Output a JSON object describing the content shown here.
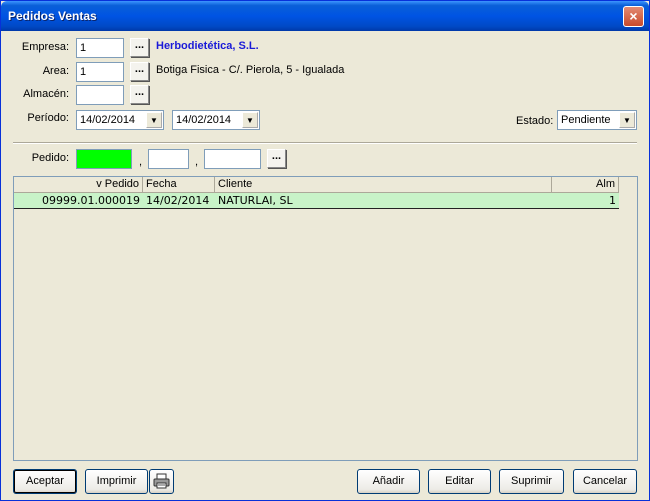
{
  "window": {
    "title": "Pedidos Ventas",
    "close_label": "×"
  },
  "form": {
    "empresa_label": "Empresa:",
    "empresa_value": "1",
    "empresa_name": "Herbodietética, S.L.",
    "area_label": "Area:",
    "area_value": "1",
    "area_name": "Botiga Fisica - C/. Pierola, 5 - Igualada",
    "almacen_label": "Almacén:",
    "almacen_value": "",
    "periodo_label": "Período:",
    "periodo_from": "14/02/2014",
    "periodo_to": "14/02/2014",
    "estado_label": "Estado:",
    "estado_value": "Pendiente",
    "pedido_label": "Pedido:",
    "pedido_sep1": ",",
    "pedido_sep2": ",",
    "dots": "...",
    "dropdown_arrow": "▼"
  },
  "grid": {
    "columns": [
      "v Pedido",
      "Fecha",
      "Cliente",
      "Alm"
    ],
    "rows": [
      {
        "pedido": "09999.01.000019",
        "fecha": "14/02/2014",
        "cliente": "NATURLAI, SL",
        "alm": "1"
      }
    ]
  },
  "buttons": {
    "aceptar": "Aceptar",
    "imprimir": "Imprimir",
    "printer_icon": "printer-icon",
    "anadir": "Añadir",
    "editar": "Editar",
    "suprimir": "Suprimir",
    "cancelar": "Cancelar"
  },
  "colors": {
    "titlebar": "#0054e3",
    "window_bg": "#ece9d8",
    "company_name": "#1a1ad8",
    "pedido_field": "#00ff00",
    "selected_row": "#c8f3c8"
  }
}
